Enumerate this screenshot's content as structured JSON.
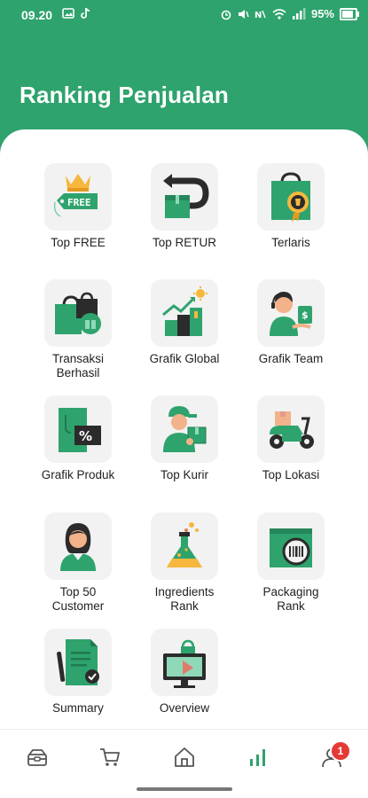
{
  "status_bar": {
    "time": "09.20",
    "battery": "95%"
  },
  "title": "Ranking Penjualan",
  "tiles": [
    {
      "label": "Top FREE",
      "icon": "free-tag-crown-icon"
    },
    {
      "label": "Top RETUR",
      "icon": "return-box-icon"
    },
    {
      "label": "Terlaris",
      "icon": "best-seller-bag-icon"
    },
    {
      "label": "Transaksi\nBerhasil",
      "icon": "shopping-bags-icon"
    },
    {
      "label": "Grafik Global",
      "icon": "growth-chart-icon"
    },
    {
      "label": "Grafik Team",
      "icon": "team-support-icon"
    },
    {
      "label": "Grafik Produk",
      "icon": "product-discount-icon"
    },
    {
      "label": "Top Kurir",
      "icon": "courier-icon"
    },
    {
      "label": "Top Lokasi",
      "icon": "delivery-scooter-icon"
    },
    {
      "label": "Top 50\nCustomer",
      "icon": "customer-icon"
    },
    {
      "label": "Ingredients\nRank",
      "icon": "flask-icon"
    },
    {
      "label": "Packaging\nRank",
      "icon": "barcode-package-icon"
    },
    {
      "label": "Summary",
      "icon": "document-summary-icon"
    },
    {
      "label": "Overview",
      "icon": "monitor-overview-icon"
    }
  ],
  "bottom_nav": {
    "items": [
      "wallet-icon",
      "cart-icon",
      "home-icon",
      "bar-chart-icon",
      "profile-icon"
    ],
    "active": "bar-chart-icon",
    "notification_count": "1"
  },
  "colors": {
    "primary": "#2ea36d",
    "icon_dark": "#2b2b2b",
    "badge": "#e53935"
  }
}
